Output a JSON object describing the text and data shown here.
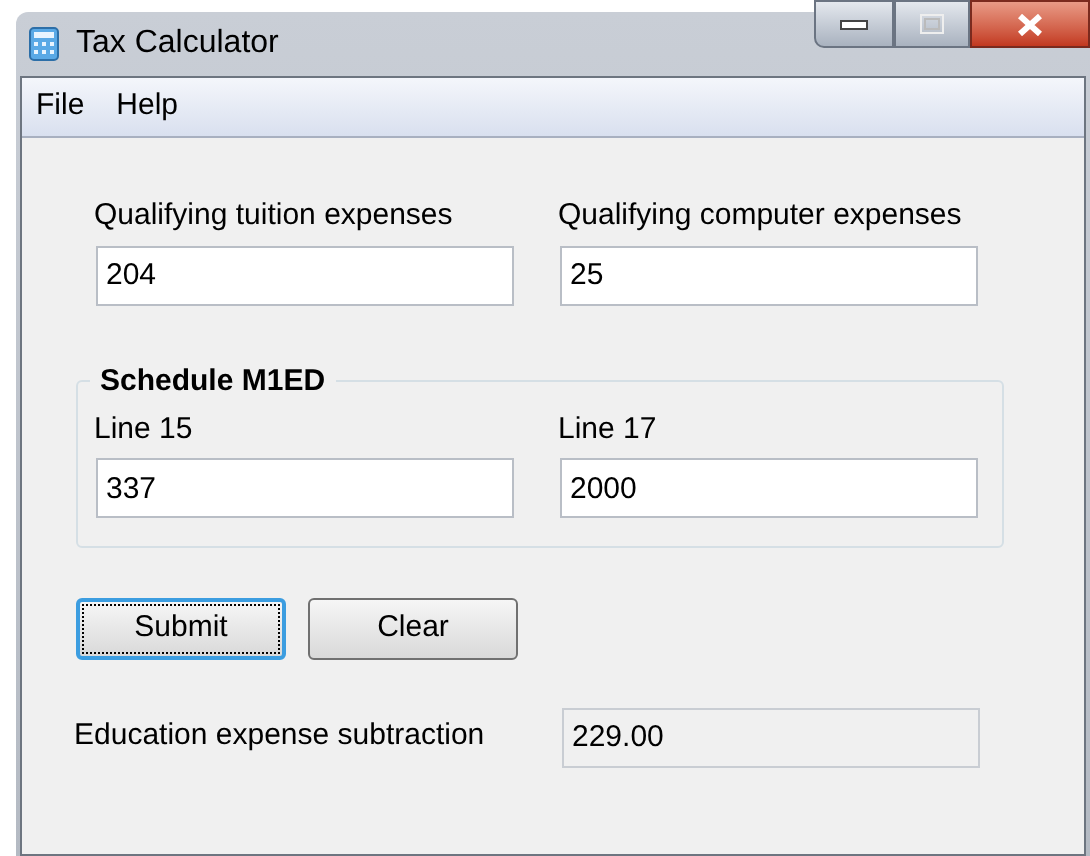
{
  "window": {
    "title": "Tax Calculator"
  },
  "menu": [
    {
      "label": "File"
    },
    {
      "label": "Help"
    }
  ],
  "top_fields": [
    {
      "label": "Qualifying tuition expenses",
      "value": "204"
    },
    {
      "label": "Qualifying computer expenses",
      "value": "25"
    }
  ],
  "group": {
    "title": "Schedule M1ED",
    "fields": [
      {
        "label": "Line 15",
        "value": "337"
      },
      {
        "label": "Line 17",
        "value": "2000"
      }
    ]
  },
  "buttons": [
    {
      "label": "Submit",
      "focused": true
    },
    {
      "label": "Clear",
      "focused": false
    }
  ],
  "result": {
    "label": "Education expense subtraction",
    "value": "229.00",
    "readonly": true
  }
}
